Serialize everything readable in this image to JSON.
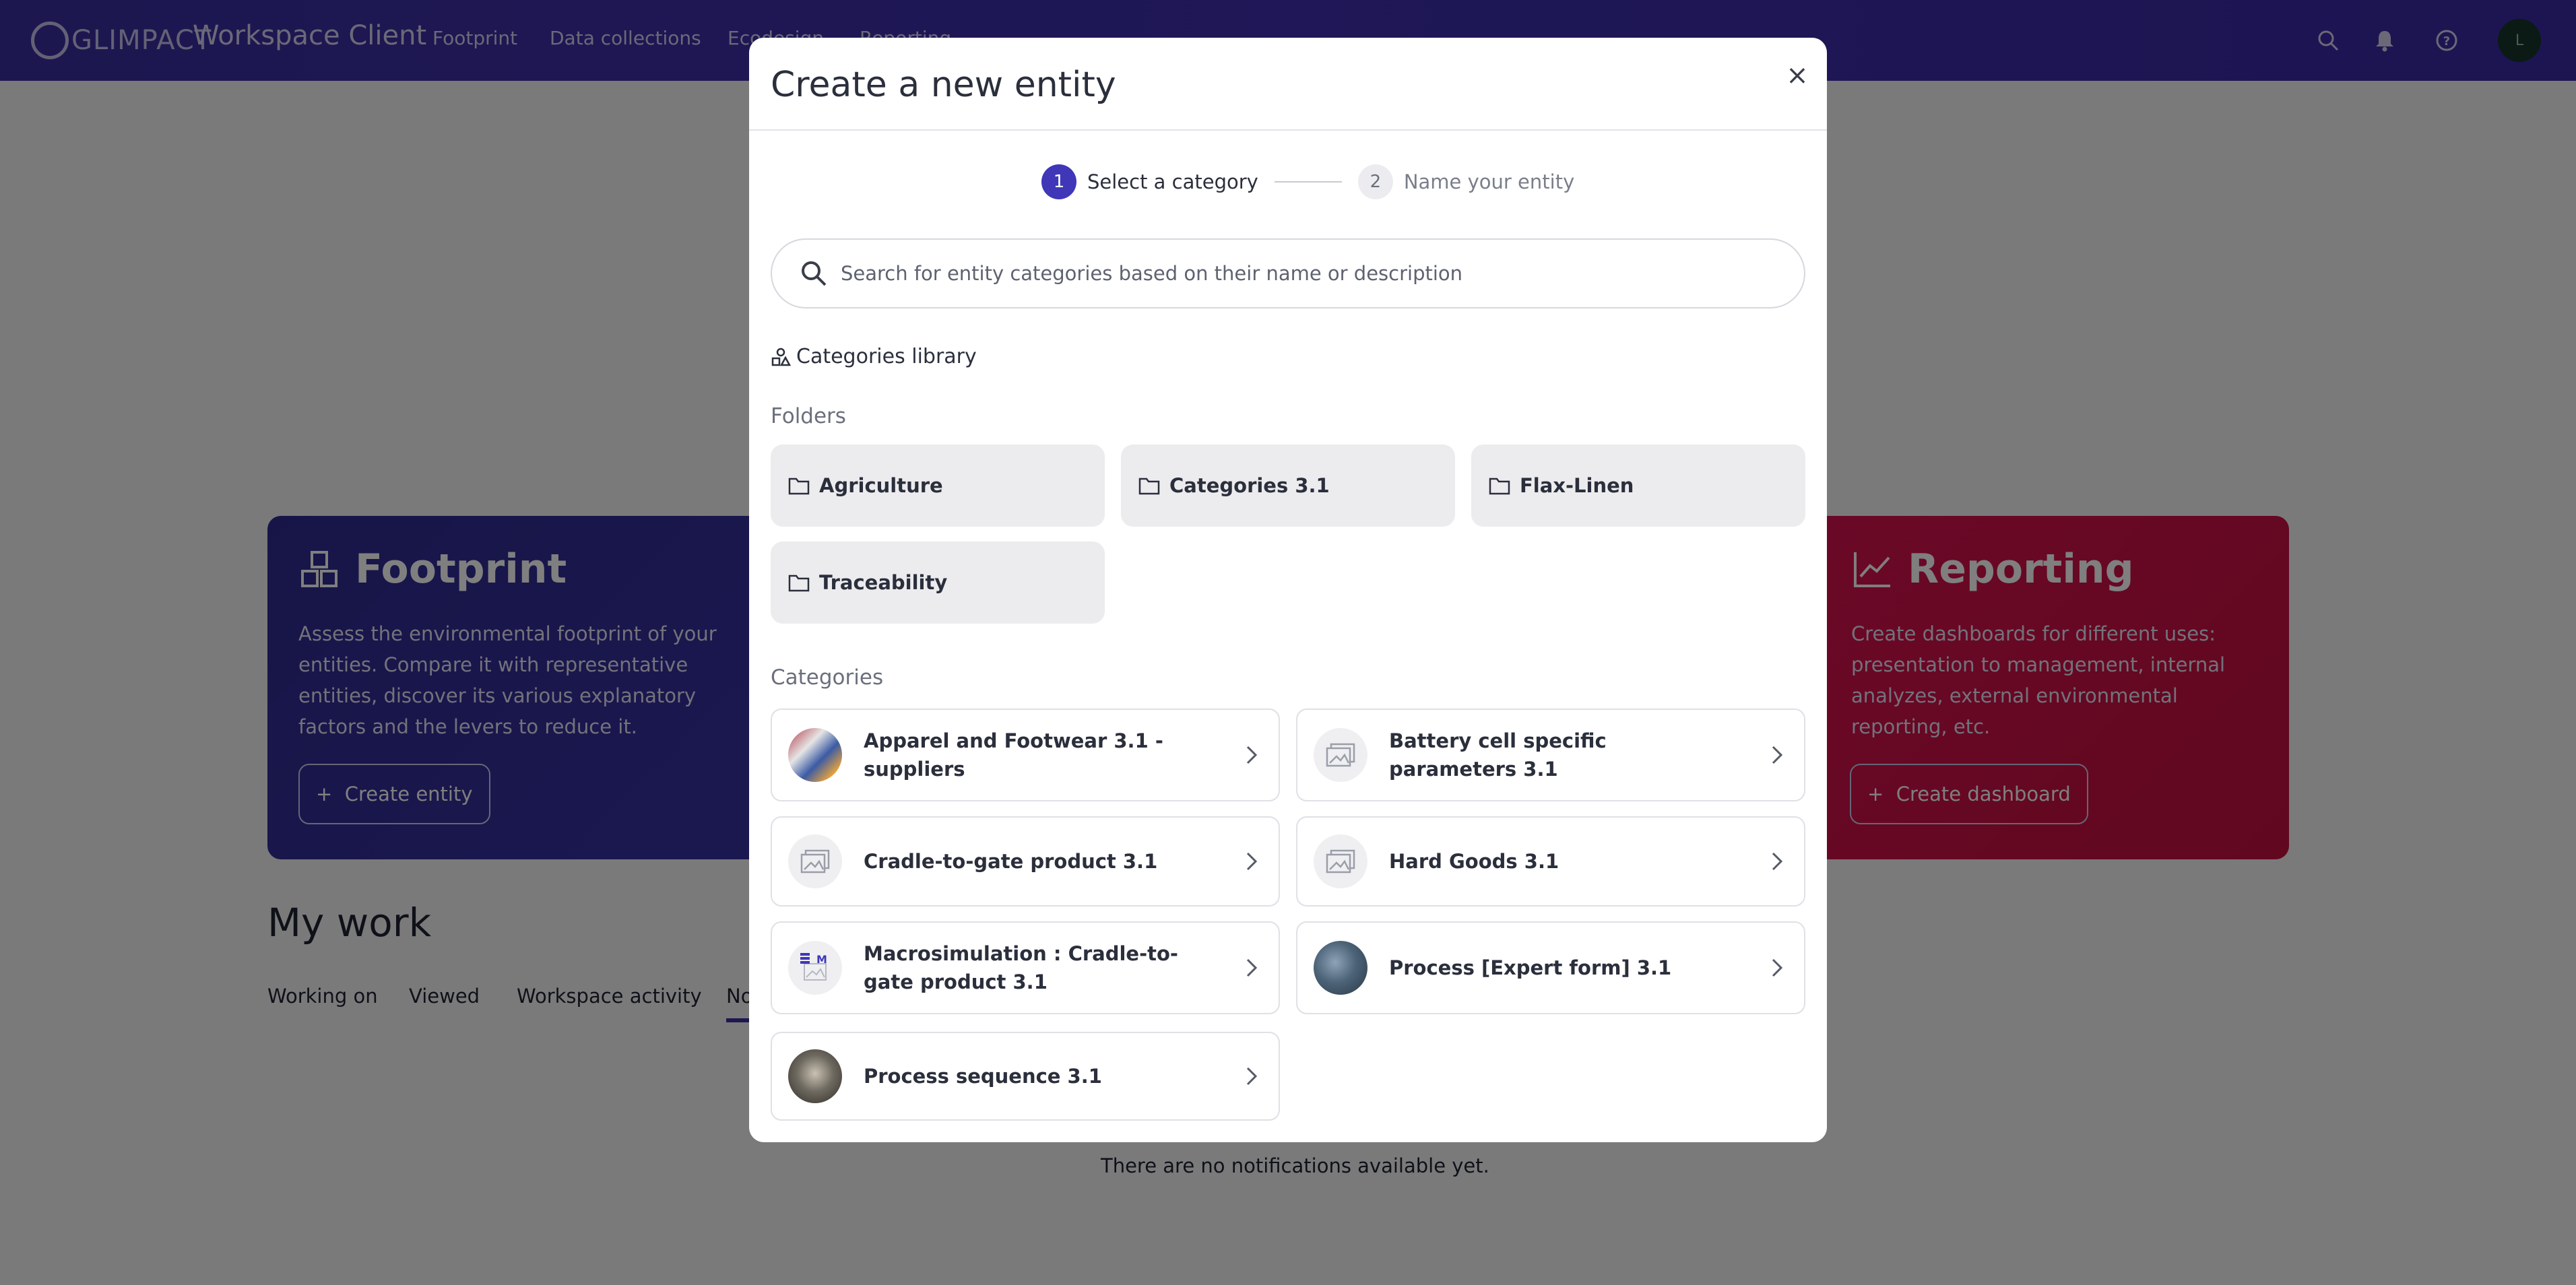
{
  "topbar": {
    "brand": "GLIMPACT",
    "app_title": "Workspace Client",
    "nav": [
      "Footprint",
      "Data collections",
      "Ecodesign",
      "Reporting"
    ],
    "avatar_initial": "L",
    "colors": {
      "background": "#3a2ea0",
      "text": "#d6d3f0"
    }
  },
  "background_page": {
    "footprint_card": {
      "title": "Footprint",
      "description": "Assess the environmental footprint of your entities. Compare it with representative entities, discover its various explanatory factors and the levers to reduce it.",
      "button": "Create entity"
    },
    "reporting_card": {
      "title": "Reporting",
      "description": "Create dashboards for different uses: presentation to management, internal analyzes, external environmental reporting, etc.",
      "button": "Create dashboard"
    },
    "mywork": {
      "title": "My work",
      "tabs": [
        "Working on",
        "Viewed",
        "Workspace activity",
        "No"
      ],
      "empty_message": "There are no notifications available yet."
    }
  },
  "modal": {
    "title": "Create a new entity",
    "close_label": "×",
    "steps": [
      {
        "number": "1",
        "label": "Select a category",
        "active": true
      },
      {
        "number": "2",
        "label": "Name your entity",
        "active": false
      }
    ],
    "search_placeholder": "Search for entity categories based on their name or description",
    "library_title": "Categories library",
    "folders_label": "Folders",
    "folders": [
      "Agriculture",
      "Categories 3.1",
      "Flax-Linen",
      "Traceability"
    ],
    "categories_label": "Categories",
    "categories": [
      {
        "label": "Apparel and Footwear 3.1 - suppliers",
        "icon": "apparel-photo"
      },
      {
        "label": "Battery cell specific parameters 3.1",
        "icon": "image-placeholder-icon"
      },
      {
        "label": "Cradle-to-gate product 3.1",
        "icon": "image-placeholder-icon"
      },
      {
        "label": "Hard Goods 3.1",
        "icon": "image-placeholder-icon"
      },
      {
        "label": "Macrosimulation : Cradle-to-gate product 3.1",
        "icon": "macrosimulation-icon"
      },
      {
        "label": "Process [Expert form] 3.1",
        "icon": "factory-photo"
      },
      {
        "label": "Process sequence 3.1",
        "icon": "process-photo"
      }
    ],
    "accent_color": "#3f37b8"
  }
}
